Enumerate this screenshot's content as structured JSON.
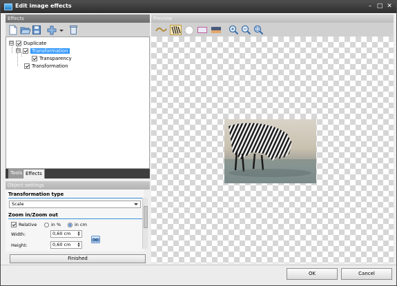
{
  "window": {
    "title": "Edit image effects",
    "controls": [
      "–",
      "□",
      "✕"
    ]
  },
  "effects_panel": {
    "header": "Effects",
    "toolbar_icons": [
      "new-icon",
      "open-folder-icon",
      "save-icon",
      "add-effect-icon",
      "dropdown-arrow-icon",
      "delete-icon"
    ]
  },
  "tree": {
    "items": [
      {
        "label": "Duplicate",
        "expander": "⊟",
        "checked": true
      },
      {
        "label": "Transformation",
        "expander": "⊟",
        "checked": true,
        "selected": true
      },
      {
        "label": "Transparency",
        "checked": true
      },
      {
        "label": "Transformation",
        "checked": true
      }
    ]
  },
  "tabs": {
    "tools": "Tools",
    "effects": "Effects"
  },
  "object_settings": {
    "header": "Object settings",
    "transformation_type_title": "Transformation type",
    "transformation_type_value": "Scale",
    "zoom_title": "Zoom in/Zoom out",
    "relative_label": "Relative",
    "unit_percent": "in %",
    "unit_cm": "in cm",
    "width_label": "Width:",
    "width_value": "0,60 cm",
    "height_label": "Height:",
    "height_value": "0,60 cm",
    "finished": "Finished"
  },
  "preview_panel": {
    "header": "Preview",
    "toolbar_icons": [
      "background-pattern-icon",
      "zebra-thumbnail-icon",
      "white-background-icon",
      "frame-icon",
      "color-bar-icon",
      "zoom-in-icon",
      "zoom-out-icon",
      "zoom-fit-icon"
    ]
  },
  "buttons": {
    "ok": "OK",
    "cancel": "Cancel"
  }
}
